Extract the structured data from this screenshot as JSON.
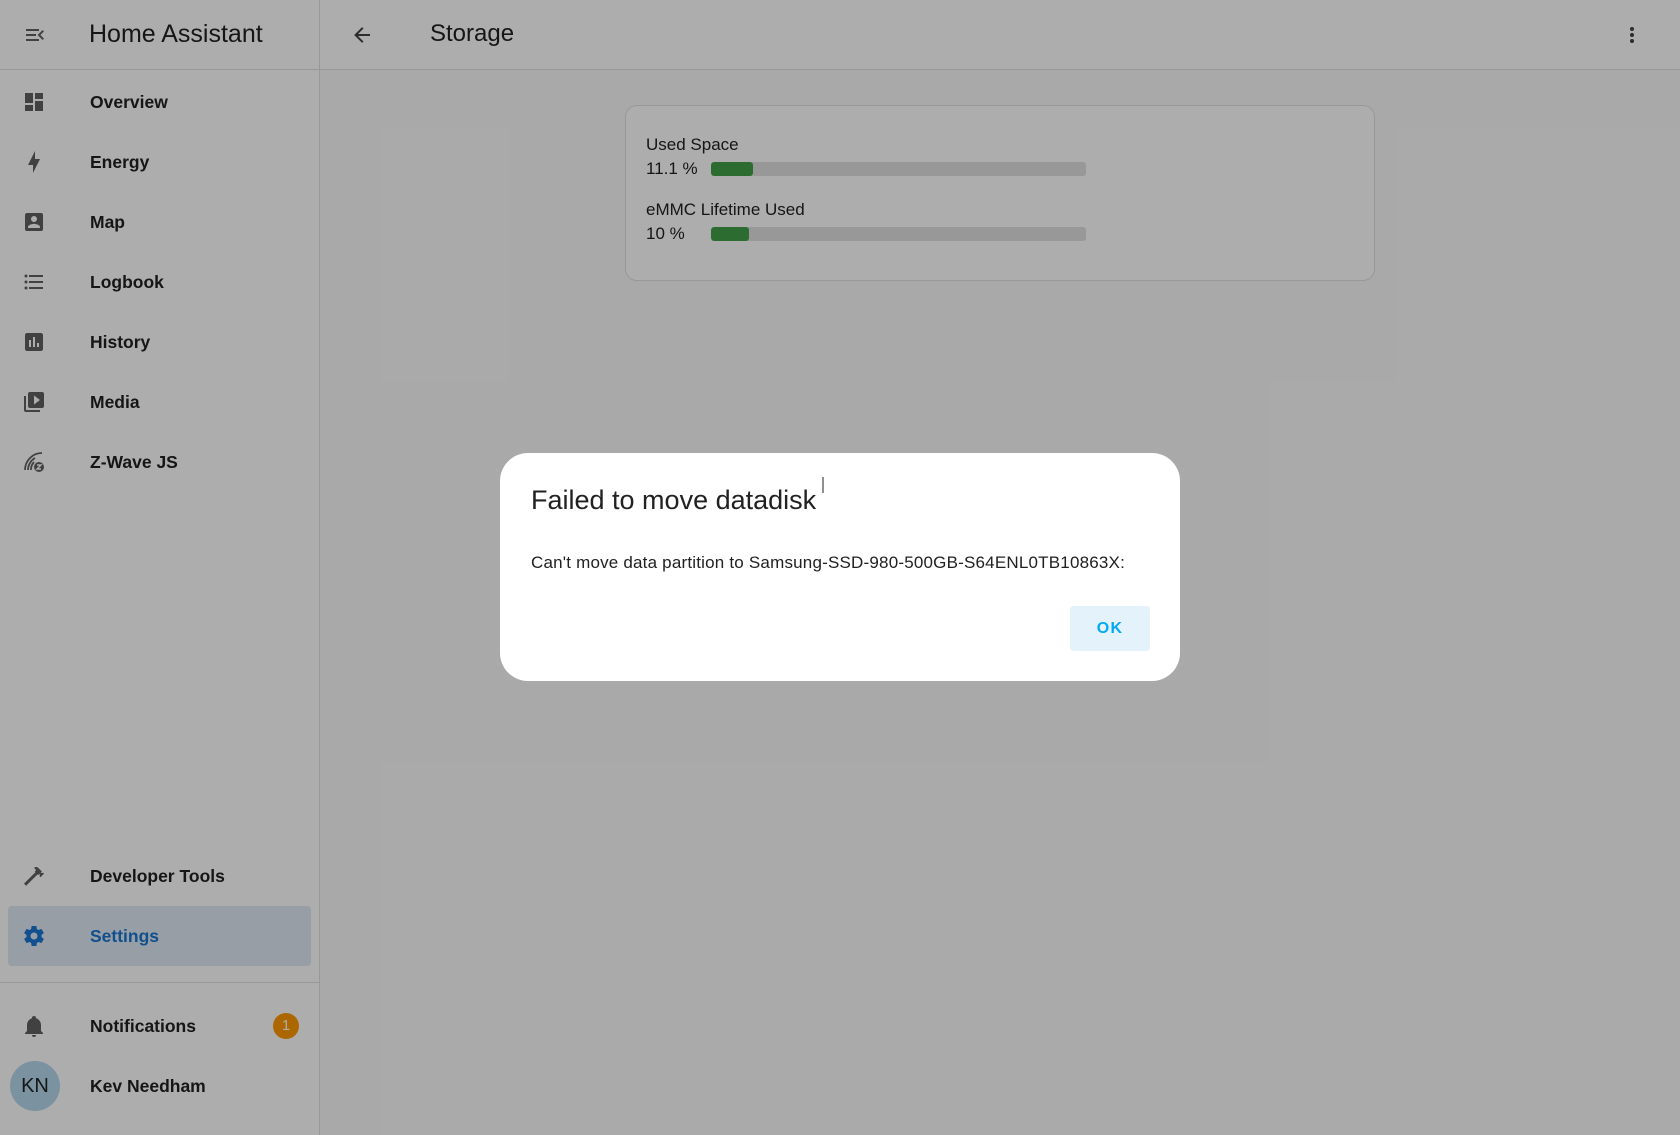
{
  "app": {
    "title": "Home Assistant"
  },
  "sidebar": {
    "items": [
      {
        "label": "Overview",
        "icon": "dashboard-icon"
      },
      {
        "label": "Energy",
        "icon": "lightning-bolt-icon"
      },
      {
        "label": "Map",
        "icon": "account-box-icon"
      },
      {
        "label": "Logbook",
        "icon": "format-list-bulleted-icon"
      },
      {
        "label": "History",
        "icon": "chart-box-icon"
      },
      {
        "label": "Media",
        "icon": "play-box-multiple-icon"
      },
      {
        "label": "Z-Wave JS",
        "icon": "z-wave-icon"
      }
    ],
    "bottom_items": [
      {
        "label": "Developer Tools",
        "icon": "hammer-icon"
      },
      {
        "label": "Settings",
        "icon": "gear-icon",
        "active": true
      }
    ],
    "notifications": {
      "label": "Notifications",
      "count": "1"
    },
    "user": {
      "initials": "KN",
      "name": "Kev Needham"
    }
  },
  "topbar": {
    "title": "Storage"
  },
  "storage": {
    "used_space": {
      "label": "Used Space",
      "value": "11.1 %",
      "fraction": 0.111
    },
    "emmc": {
      "label": "eMMC Lifetime Used",
      "value": "10 %",
      "fraction": 0.1
    }
  },
  "dialog": {
    "title": "Failed to move datadisk",
    "message": "Can't move data partition to Samsung-SSD-980-500GB-S64ENL0TB10863X:",
    "ok_label": "OK"
  },
  "colors": {
    "accent": "#03a9f4",
    "progress": "#43a047",
    "badge": "#ff9800"
  }
}
